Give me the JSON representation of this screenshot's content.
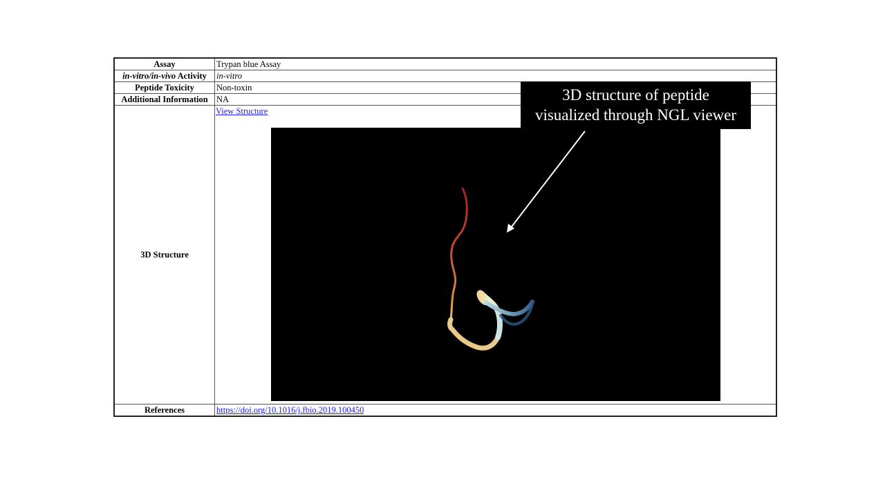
{
  "table": {
    "rows": [
      {
        "label": "Assay",
        "value": "Trypan blue Assay"
      },
      {
        "label_italic": "in-vitro/in-vivo",
        "label_rest": " Activity",
        "value": "in-vitro"
      },
      {
        "label": "Peptide Toxicity",
        "value": "Non-toxin"
      },
      {
        "label": "Additional Information",
        "value": "NA"
      }
    ],
    "structure": {
      "label": "3D Structure",
      "link_text": "View Structure"
    },
    "references": {
      "label": "References",
      "link_text": "https://doi.org/10.1016/j.fbio.2019.100450"
    }
  },
  "annotation": {
    "line1": "3D structure of peptide",
    "line2": "visualized through NGL viewer"
  },
  "viewer": {
    "background": "#000000",
    "ribbon_colors": [
      "#b0282c",
      "#d7703a",
      "#f2dca0",
      "#c8e6e8",
      "#3f6a96"
    ]
  }
}
